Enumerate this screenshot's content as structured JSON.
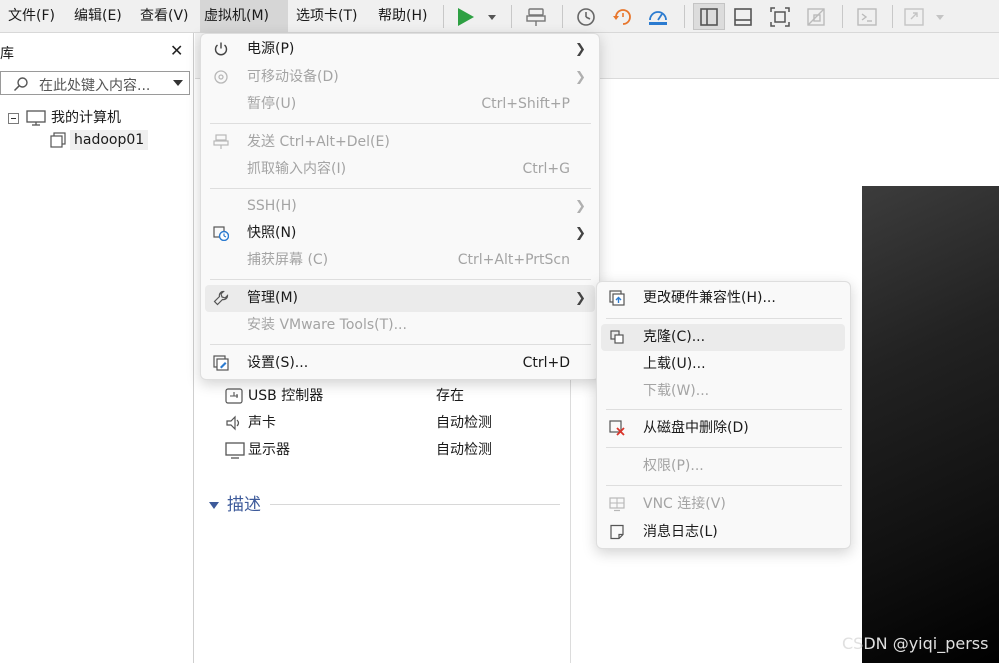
{
  "menubar": {
    "items": [
      "文件(F)",
      "编辑(E)",
      "查看(V)",
      "虚拟机(M)",
      "选项卡(T)",
      "帮助(H)"
    ]
  },
  "library": {
    "title": "库",
    "search_placeholder": "在此处键入内容...",
    "root_label": "我的计算机",
    "vm_label": "hadoop01"
  },
  "hardware": [
    {
      "name": "USB 控制器",
      "value": "存在"
    },
    {
      "name": "声卡",
      "value": "自动检测"
    },
    {
      "name": "显示器",
      "value": "自动检测"
    }
  ],
  "description_heading": "描述",
  "vm_menu": {
    "items": [
      {
        "label": "电源(P)",
        "accel": "",
        "submenu": true,
        "enabled": true,
        "icon": "power-icon"
      },
      {
        "label": "可移动设备(D)",
        "accel": "",
        "submenu": true,
        "enabled": false,
        "icon": "removable-device-icon"
      },
      {
        "label": "暂停(U)",
        "accel": "Ctrl+Shift+P",
        "submenu": false,
        "enabled": false,
        "icon": ""
      },
      {
        "label": "发送 Ctrl+Alt+Del(E)",
        "accel": "",
        "submenu": false,
        "enabled": false,
        "icon": "send-keys-icon"
      },
      {
        "label": "抓取输入内容(I)",
        "accel": "Ctrl+G",
        "submenu": false,
        "enabled": false,
        "icon": ""
      },
      {
        "label": "SSH(H)",
        "accel": "",
        "submenu": true,
        "enabled": false,
        "icon": ""
      },
      {
        "label": "快照(N)",
        "accel": "",
        "submenu": true,
        "enabled": true,
        "icon": "snapshot-icon"
      },
      {
        "label": "捕获屏幕 (C)",
        "accel": "Ctrl+Alt+PrtScn",
        "submenu": false,
        "enabled": false,
        "icon": ""
      },
      {
        "label": "管理(M)",
        "accel": "",
        "submenu": true,
        "enabled": true,
        "icon": "wrench-icon"
      },
      {
        "label": "安装 VMware Tools(T)...",
        "accel": "",
        "submenu": false,
        "enabled": false,
        "icon": ""
      },
      {
        "label": "设置(S)...",
        "accel": "Ctrl+D",
        "submenu": false,
        "enabled": true,
        "icon": "settings-icon"
      }
    ]
  },
  "manage_menu": {
    "items": [
      {
        "label": "更改硬件兼容性(H)...",
        "enabled": true,
        "icon": "hardware-compat-icon"
      },
      {
        "label": "克隆(C)...",
        "enabled": true,
        "icon": "clone-icon"
      },
      {
        "label": "上载(U)...",
        "enabled": true,
        "icon": ""
      },
      {
        "label": "下载(W)...",
        "enabled": false,
        "icon": ""
      },
      {
        "label": "从磁盘中删除(D)",
        "enabled": true,
        "icon": "delete-from-disk-icon"
      },
      {
        "label": "权限(P)...",
        "enabled": false,
        "icon": ""
      },
      {
        "label": "VNC 连接(V)",
        "enabled": false,
        "icon": "vnc-icon"
      },
      {
        "label": "消息日志(L)",
        "enabled": true,
        "icon": "message-log-icon"
      }
    ]
  },
  "watermark": "CSDN @yiqi_perss",
  "colors": {
    "menubar_bg": "#f0f0f0",
    "menu_bg": "#f9f9f9",
    "highlight": "#ebebeb",
    "disabled_text": "#a4a4a4",
    "run_green": "#2ea043",
    "accent_blue": "#2b7bd0",
    "accent_orange": "#e8762c",
    "delete_red": "#d9342b"
  }
}
